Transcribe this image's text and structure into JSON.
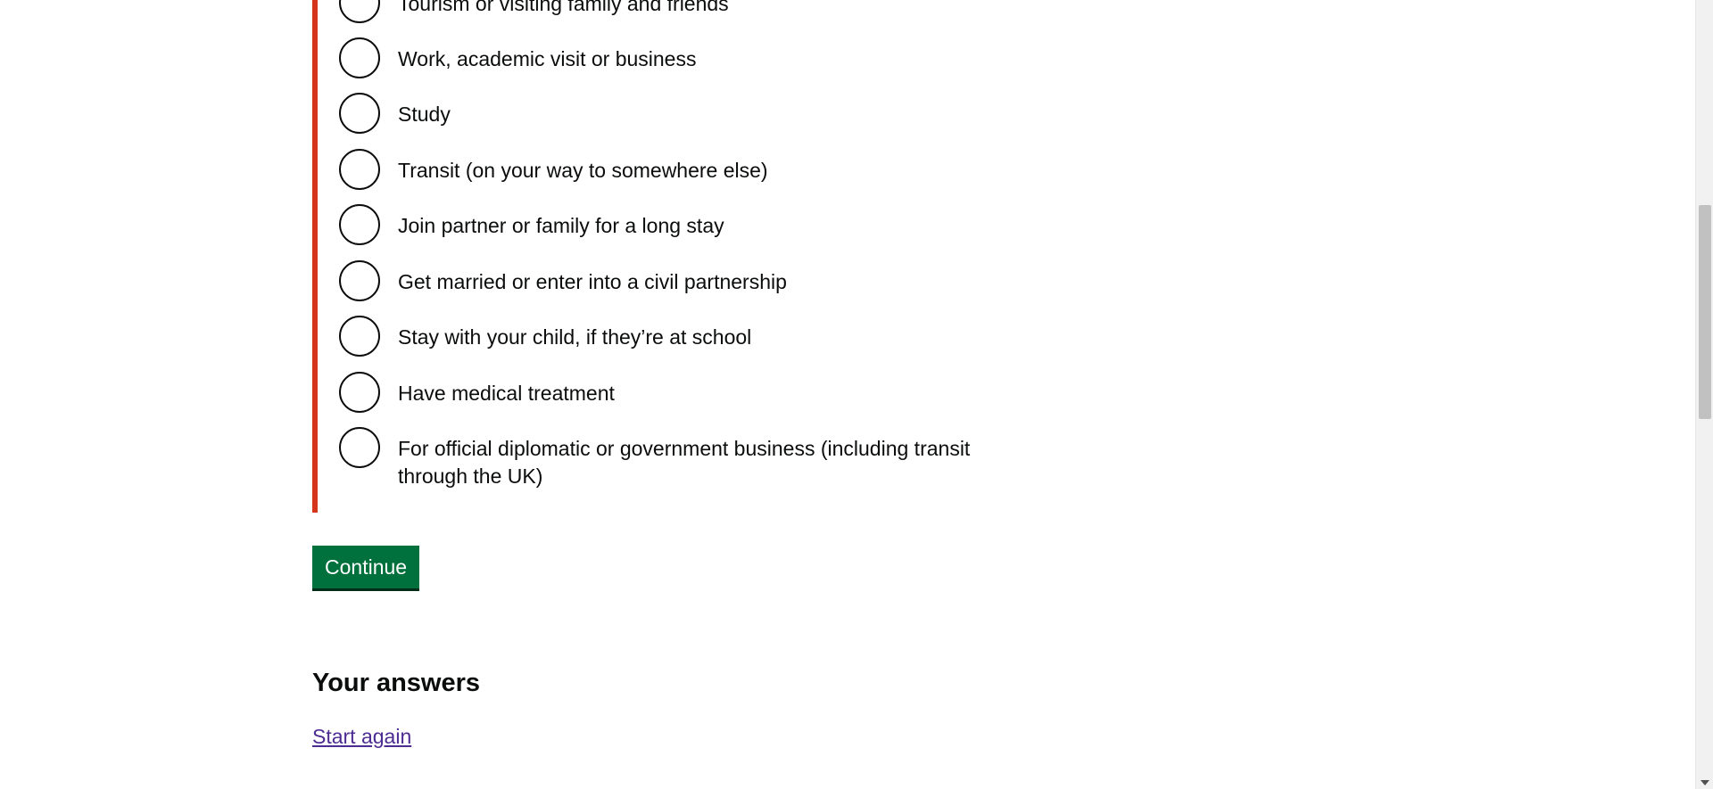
{
  "form": {
    "options": [
      {
        "label": "Tourism or visiting family and friends"
      },
      {
        "label": "Work, academic visit or business"
      },
      {
        "label": "Study"
      },
      {
        "label": "Transit (on your way to somewhere else)"
      },
      {
        "label": "Join partner or family for a long stay"
      },
      {
        "label": "Get married or enter into a civil partnership"
      },
      {
        "label": "Stay with your child, if they’re at school"
      },
      {
        "label": "Have medical treatment"
      },
      {
        "label": "For official diplomatic or government business (including transit through the UK)"
      }
    ],
    "continue_label": "Continue"
  },
  "answers": {
    "heading": "Your answers",
    "start_again_label": "Start again"
  },
  "colors": {
    "error_border": "#d4351c",
    "button_green": "#00703c",
    "link_purple": "#4c2c92"
  }
}
